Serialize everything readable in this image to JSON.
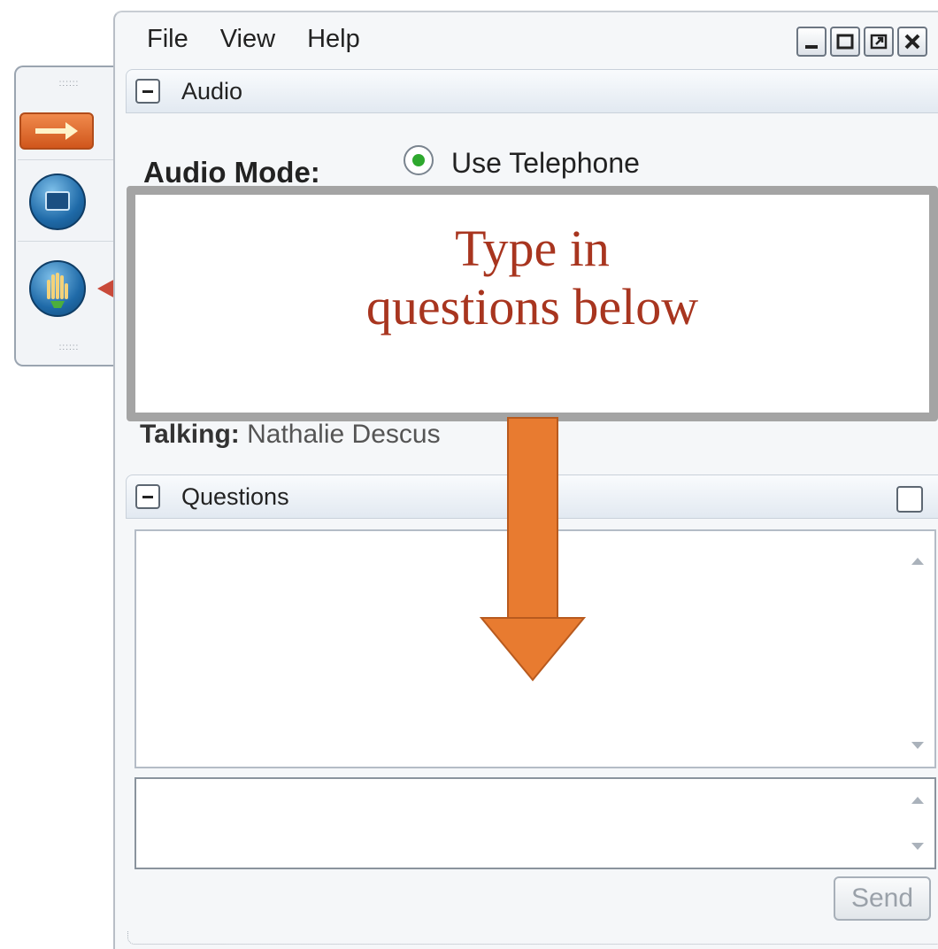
{
  "menu": {
    "file": "File",
    "view": "View",
    "help": "Help"
  },
  "audio": {
    "section_title": "Audio",
    "mode_label": "Audio Mode:",
    "radio_option": "Use Telephone",
    "talking_label": "Talking:",
    "talking_name": "Nathalie Descus"
  },
  "questions": {
    "section_title": "Questions",
    "send_label": "Send"
  },
  "callout": {
    "line1": "Type in",
    "line2": "questions below"
  },
  "colors": {
    "callout_text": "#a8351f",
    "callout_border": "#a4a4a4",
    "arrow": "#e87b30",
    "radio_selected": "#2ea82e"
  },
  "icons": {
    "toolbar_arrow": "arrow-right-icon",
    "toolbar_screen": "screen-share-icon",
    "toolbar_hand": "raise-hand-icon"
  }
}
